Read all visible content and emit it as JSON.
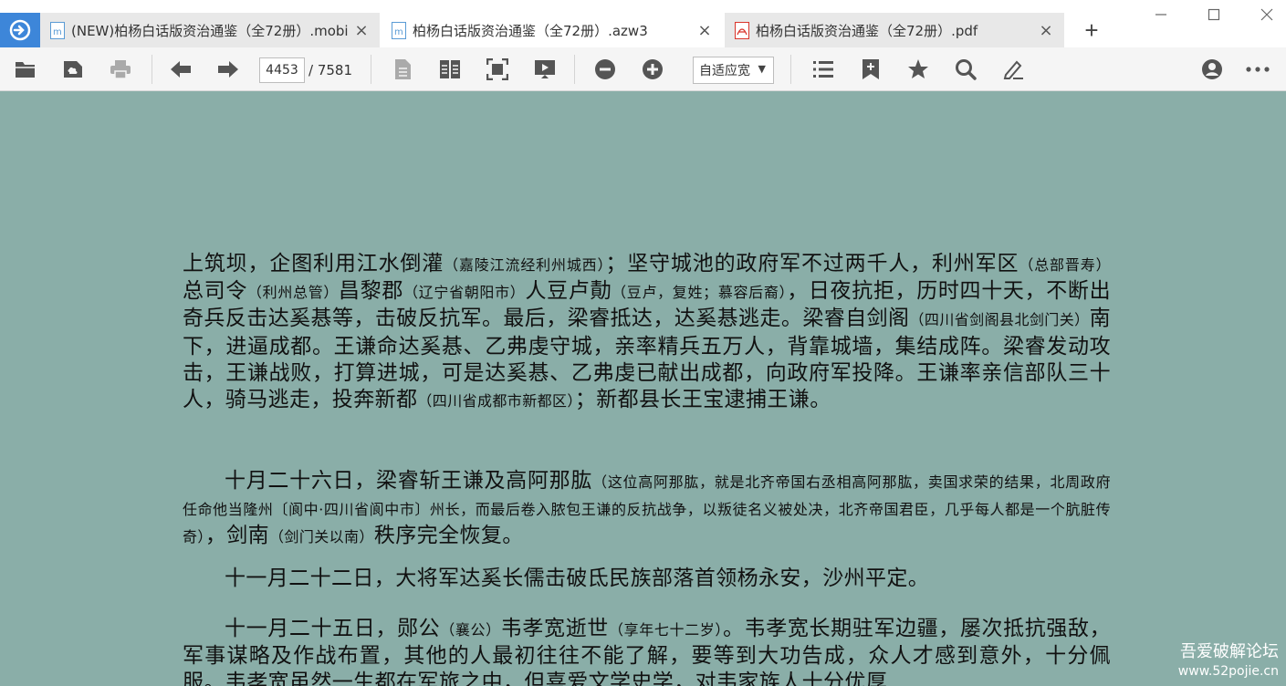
{
  "tabs": [
    {
      "label": "(NEW)柏杨白话版资治通鉴（全72册）.mobi",
      "icon": "mobi-file-icon",
      "close": "×"
    },
    {
      "label": "柏杨白话版资治通鉴（全72册）.azw3",
      "icon": "azw3-file-icon",
      "close": "×"
    },
    {
      "label": "柏杨白话版资治通鉴（全72册）.pdf",
      "icon": "pdf-file-icon",
      "close": "×"
    }
  ],
  "new_tab": "+",
  "toolbar": {
    "page_current": "4453",
    "page_total": "/ 7581",
    "zoom": "自适应宽",
    "zoom_caret": "▼"
  },
  "document": {
    "p1": {
      "a": "上筑坝，企图利用江水倒灌",
      "n1": "（嘉陵江流经利州城西）",
      "b": "；坚守城池的政府军不过两千人，利州军区",
      "n2": "（总部晋寿）",
      "c": "总司令",
      "n3": "（利州总管）",
      "d": "昌黎郡",
      "n4": "（辽宁省朝阳市）",
      "e": "人豆卢勣",
      "n5": "（豆卢，复姓；慕容后裔）",
      "f": "，日夜抗拒，历时四十天，不断出奇兵反击达奚惎等，击破反抗军。最后，梁睿抵达，达奚惎逃走。梁睿自剑阁",
      "n6": "（四川省剑阁县北剑门关）",
      "g": "南下，进逼成都。王谦命达奚惎、乙弗虔守城，亲率精兵五万人，背靠城墙，集结成阵。梁睿发动攻击，王谦战败，打算进城，可是达奚惎、乙弗虔已献出成都，向政府军投降。王谦率亲信部队三十人，骑马逃走，投奔新都",
      "n7": "（四川省成都市新都区）",
      "h": "；新都县长王宝逮捕王谦。"
    },
    "p2": {
      "a": "十月二十六日，梁睿斩王谦及高阿那肱",
      "n1": "（这位高阿那肱，就是北齐帝国右丞相高阿那肱，卖国求荣的结果，北周政府任命他当隆州〔阆中·四川省阆中市〕州长，而最后卷入脓包王谦的反抗战争，以叛徒名义被处决，北齐帝国君臣，几乎每人都是一个肮脏传奇）",
      "b": "，剑南",
      "n2": "（剑门关以南）",
      "c": "秩序完全恢复。"
    },
    "p3": {
      "a": "十一月二十二日，大将军达奚长儒击破氐民族部落首领杨永安，沙州平定。"
    },
    "p4": {
      "a": "十一月二十五日，郧公",
      "n1": "（襄公）",
      "b": "韦孝宽逝世",
      "n2": "（享年七十二岁）",
      "c": "。韦孝宽长期驻军边疆，屡次抵抗强敌，军事谋略及作战布置，其他的人最初往往不能了解，要等到大功告成，众人才感到意外，十分佩服。韦孝宽虽然一生都在军旅之中，但喜爱文学史学，对韦家族人十分优厚"
    }
  },
  "watermark": {
    "line1": "吾爱破解论坛",
    "line2": "www.52pojie.cn"
  }
}
